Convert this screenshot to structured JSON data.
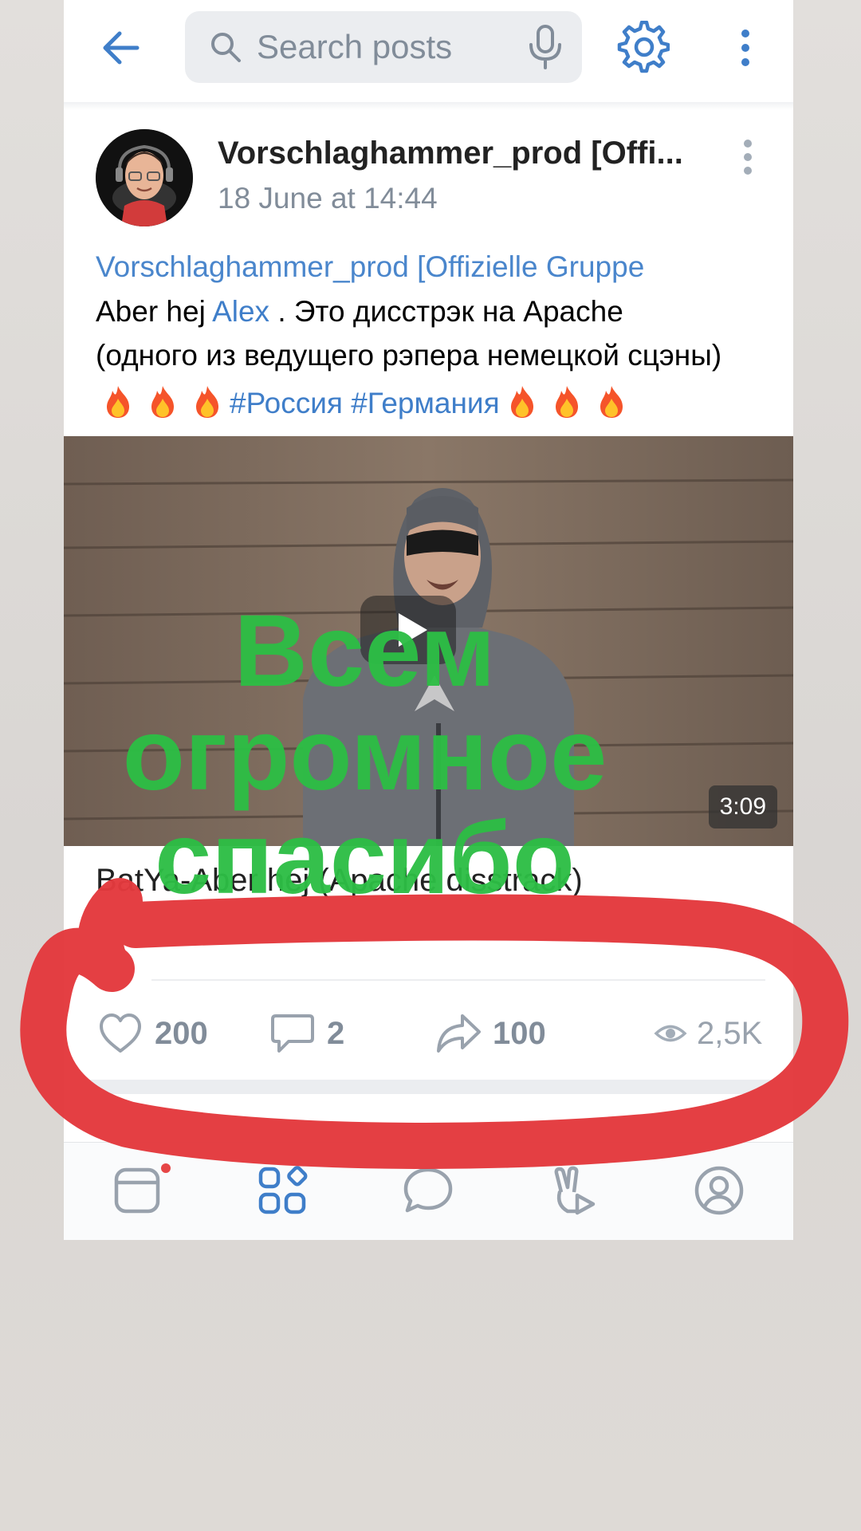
{
  "header": {
    "search_placeholder": "Search posts"
  },
  "post": {
    "author": "Vorschlaghammer_prod [Offi...",
    "date": "18 June at 14:44",
    "group_link": "Vorschlaghammer_prod [Offizielle Gruppe",
    "line1_prefix": "Aber hej ",
    "mention": "Alex",
    "line1_suffix": " . Это дисстрэк на Apache",
    "line2": "(одного из ведущего рэпера немецкой сцэны)",
    "hashtags": "#Россия #Германия",
    "video": {
      "overlay_text": "Всем огромное спасибо",
      "duration": "3:09",
      "title": "BatYa-Aber hej (Apache disstrack)"
    },
    "stats": {
      "likes": "200",
      "comments": "2",
      "shares": "100",
      "views": "2,5K"
    }
  },
  "colors": {
    "accent": "#3f7ec9",
    "overlay_green": "#2dbe45",
    "annotation_red": "#e3393d",
    "muted": "#818c99"
  },
  "icons": {
    "back": "arrow-left-icon",
    "search": "search-icon",
    "mic": "microphone-icon",
    "settings": "gear-icon",
    "more": "more-vertical-icon",
    "like": "heart-icon",
    "comment": "comment-icon",
    "share": "share-arrow-icon",
    "views": "eye-icon",
    "nav": [
      "news-icon",
      "services-icon",
      "messages-icon",
      "clips-icon",
      "profile-icon"
    ]
  }
}
